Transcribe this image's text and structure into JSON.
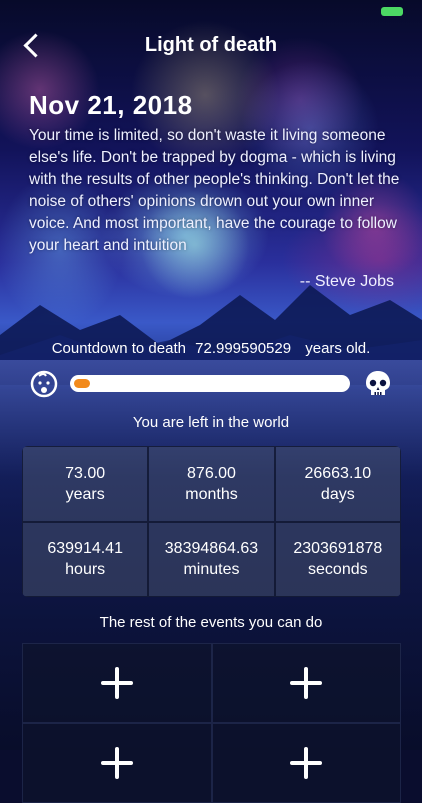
{
  "header": {
    "title": "Light of death"
  },
  "date": "Nov 21, 2018",
  "quote": {
    "text": "Your time is limited, so don't waste it living someone else's life. Don't be trapped by dogma - which is living with the results of other people's thinking. Don't let the noise of others' opinions drown out your own inner voice. And most important, have the courage to follow your heart and intuition",
    "author": "-- Steve Jobs"
  },
  "countdown": {
    "label": "Countdown to death",
    "value": "72.999590529",
    "suffix": "years old."
  },
  "progress": {
    "fraction": 0.06,
    "color": "#f28a1c"
  },
  "remaining": {
    "title": "You are left in the world",
    "cells": [
      {
        "value": "73.00",
        "unit": "years"
      },
      {
        "value": "876.00",
        "unit": "months"
      },
      {
        "value": "26663.10",
        "unit": "days"
      },
      {
        "value": "639914.41",
        "unit": "hours"
      },
      {
        "value": "38394864.63",
        "unit": "minutes"
      },
      {
        "value": "2303691878",
        "unit": "seconds"
      }
    ]
  },
  "events": {
    "title": "The rest of the events you can do"
  },
  "icons": [
    "back-chevron-icon",
    "baby-icon",
    "skull-icon",
    "plus-icon"
  ],
  "colors": {
    "battery": "#4cd964",
    "progress": "#f28a1c"
  }
}
